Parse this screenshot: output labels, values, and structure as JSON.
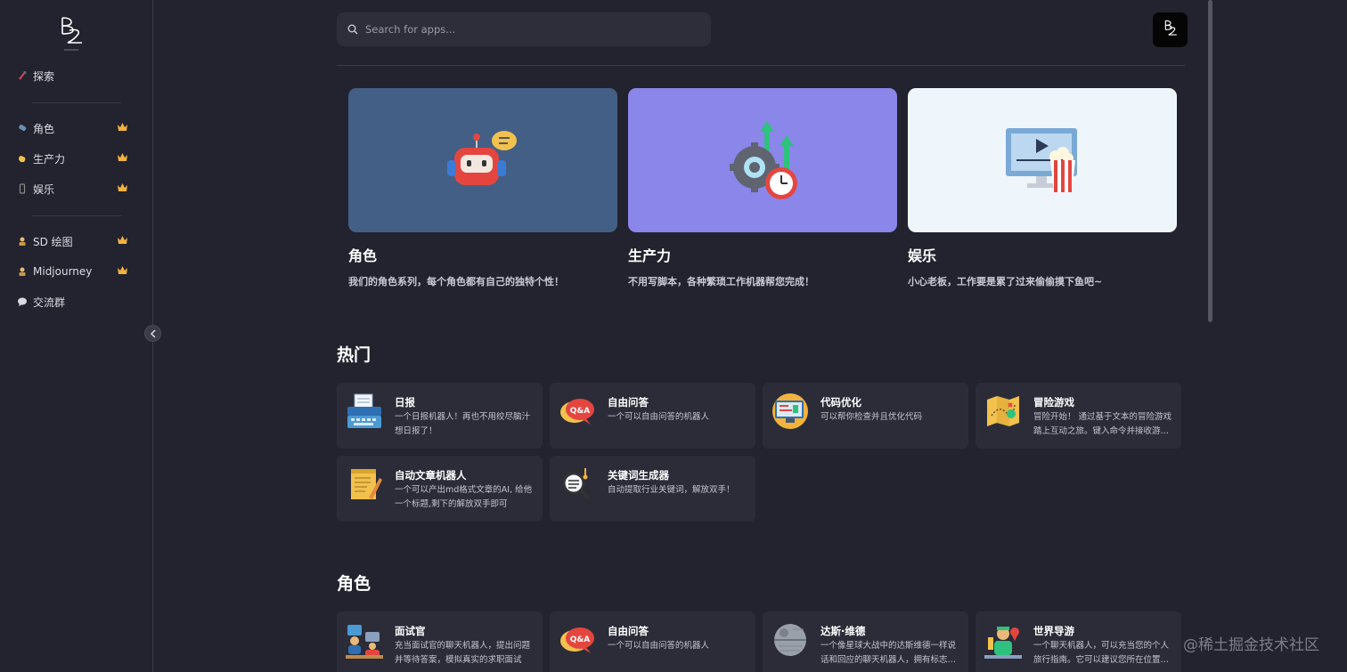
{
  "sidebar": {
    "explore": {
      "label": "探索",
      "icon": "pin-icon"
    },
    "items": [
      {
        "label": "角色",
        "icon": "flask-icon",
        "badge": "crown-icon"
      },
      {
        "label": "生产力",
        "icon": "hand-icon",
        "badge": "crown-icon"
      },
      {
        "label": "娱乐",
        "icon": "phone-icon",
        "badge": "crown-icon"
      }
    ],
    "tools": [
      {
        "label": "SD 绘图",
        "icon": "artist-icon",
        "badge": "crown-icon"
      },
      {
        "label": "Midjourney",
        "icon": "artist-icon",
        "badge": "crown-icon"
      },
      {
        "label": "交流群",
        "icon": "chat-bubble-icon"
      }
    ]
  },
  "search": {
    "placeholder": "Search for apps..."
  },
  "categories": [
    {
      "title": "角色",
      "desc": "我们的角色系列，每个角色都有自己的独特个性！",
      "color": "#435f85"
    },
    {
      "title": "生产力",
      "desc": "不用写脚本，各种繁琐工作机器帮您完成！",
      "color": "#8a86ea"
    },
    {
      "title": "娱乐",
      "desc": "小心老板，工作要是累了过来偷偷摸下鱼吧~",
      "color": "#eef6fc"
    }
  ],
  "hot": {
    "title": "热门",
    "apps": [
      {
        "name": "日报",
        "desc": "一个日报机器人！再也不用绞尽脑汁想日报了！",
        "icon": "typewriter-icon"
      },
      {
        "name": "自由问答",
        "desc": "一个可以自由问答的机器人",
        "icon": "qa-bubble-icon"
      },
      {
        "name": "代码优化",
        "desc": "可以帮你检查并且优化代码",
        "icon": "code-monitor-icon"
      },
      {
        "name": "冒险游戏",
        "desc": "冒险开始！ 通过基于文本的冒险游戏踏上互动之旅。键入命令并接收游戏回应",
        "icon": "treasure-map-icon"
      },
      {
        "name": "自动文章机器人",
        "desc": "一个可以产出md格式文章的AI, 给他一个标题,剩下的解放双手即可",
        "icon": "note-pencil-icon"
      },
      {
        "name": "关键词生成器",
        "desc": "自动提取行业关键词，解放双手！",
        "icon": "magnifier-icon"
      }
    ]
  },
  "roles": {
    "title": "角色",
    "apps": [
      {
        "name": "面试官",
        "desc": "充当面试官的聊天机器人，提出问题并等待答案，模拟真实的求职面试",
        "icon": "interviewer-icon"
      },
      {
        "name": "自由问答",
        "desc": "一个可以自由问答的机器人",
        "icon": "qa-bubble-icon"
      },
      {
        "name": "达斯·维德",
        "desc": "一个像星球大战中的达斯维德一样说话和回应的聊天机器人，拥有标志性的语气",
        "icon": "death-star-icon"
      },
      {
        "name": "世界导游",
        "desc": "一个聊天机器人，可以充当您的个人旅行指南。它可以建议您所在位置附近的景点",
        "icon": "tour-guide-icon"
      }
    ]
  },
  "watermark": "@稀土掘金技术社区"
}
